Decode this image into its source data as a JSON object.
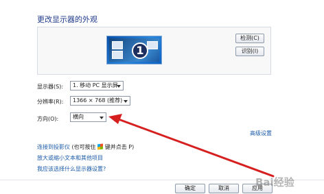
{
  "page": {
    "title": "更改显示器的外观"
  },
  "preview": {
    "monitor_number": "1",
    "detect_button": "检测(C)",
    "identify_button": "识别(I)"
  },
  "settings": {
    "display_label": "显示器(S):",
    "display_value": "1. 移动 PC 显示屏",
    "resolution_label": "分辨率(R):",
    "resolution_value": "1366 × 768 (推荐)",
    "orientation_label": "方向(O):",
    "orientation_value": "横向"
  },
  "links": {
    "advanced": "高级设置",
    "projector_link": "连接到投影仪",
    "projector_hint": "(也可按住",
    "projector_hint2": "键并点击 P)",
    "text_size": "放大或缩小文本和其他项目",
    "which_settings": "我应该选择什么显示器设置?"
  },
  "footer": {
    "ok": "确定",
    "cancel": "取消",
    "apply": "应用"
  },
  "watermark": {
    "text": "Bai经验"
  },
  "colors": {
    "arrow": "#d62020",
    "link": "#1a5aa8",
    "title": "#1e3a8a"
  }
}
